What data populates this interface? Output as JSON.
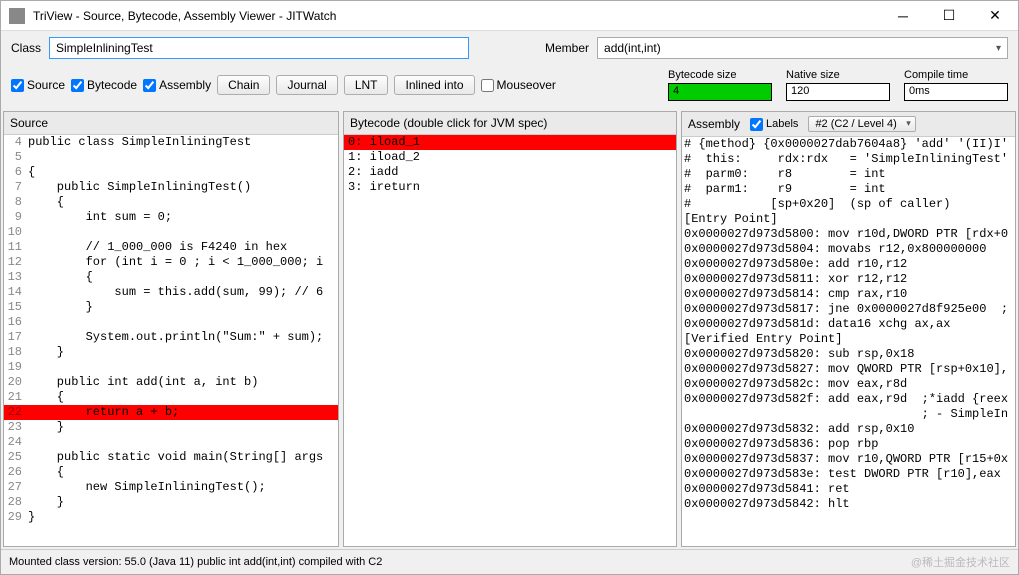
{
  "title": "TriView - Source, Bytecode, Assembly Viewer - JITWatch",
  "toolbar": {
    "class_label": "Class",
    "class_value": "SimpleInliningTest",
    "member_label": "Member",
    "member_value": "add(int,int)",
    "chk_source": "Source",
    "chk_bytecode": "Bytecode",
    "chk_assembly": "Assembly",
    "btn_chain": "Chain",
    "btn_journal": "Journal",
    "btn_lnt": "LNT",
    "btn_inlined": "Inlined into",
    "chk_mouseover": "Mouseover",
    "stats": {
      "bytecode_label": "Bytecode size",
      "bytecode_value": "4",
      "native_label": "Native size",
      "native_value": "120",
      "compile_label": "Compile time",
      "compile_value": "0ms"
    }
  },
  "panels": {
    "source": {
      "header": "Source",
      "lines": [
        {
          "n": 4,
          "t": "public class SimpleInliningTest"
        },
        {
          "n": 5,
          "t": ""
        },
        {
          "n": 6,
          "t": "{"
        },
        {
          "n": 7,
          "t": "    public SimpleInliningTest()"
        },
        {
          "n": 8,
          "t": "    {"
        },
        {
          "n": 9,
          "t": "        int sum = 0;"
        },
        {
          "n": 10,
          "t": ""
        },
        {
          "n": 11,
          "t": "        // 1_000_000 is F4240 in hex"
        },
        {
          "n": 12,
          "t": "        for (int i = 0 ; i < 1_000_000; i"
        },
        {
          "n": 13,
          "t": "        {"
        },
        {
          "n": 14,
          "t": "            sum = this.add(sum, 99); // 6"
        },
        {
          "n": 15,
          "t": "        }"
        },
        {
          "n": 16,
          "t": ""
        },
        {
          "n": 17,
          "t": "        System.out.println(\"Sum:\" + sum);"
        },
        {
          "n": 18,
          "t": "    }"
        },
        {
          "n": 19,
          "t": ""
        },
        {
          "n": 20,
          "t": "    public int add(int a, int b)"
        },
        {
          "n": 21,
          "t": "    {"
        },
        {
          "n": 22,
          "t": "        return a + b;",
          "hl": true
        },
        {
          "n": 23,
          "t": "    }"
        },
        {
          "n": 24,
          "t": ""
        },
        {
          "n": 25,
          "t": "    public static void main(String[] args"
        },
        {
          "n": 26,
          "t": "    {"
        },
        {
          "n": 27,
          "t": "        new SimpleInliningTest();"
        },
        {
          "n": 28,
          "t": "    }"
        },
        {
          "n": 29,
          "t": "}"
        }
      ]
    },
    "bytecode": {
      "header": "Bytecode (double click for JVM spec)",
      "lines": [
        {
          "t": "0: iload_1",
          "hl": true
        },
        {
          "t": "1: iload_2"
        },
        {
          "t": "2: iadd"
        },
        {
          "t": "3: ireturn"
        }
      ]
    },
    "assembly": {
      "header": "Assembly",
      "labels_chk": "Labels",
      "combo": "#2 (C2 / Level 4)",
      "lines": [
        "# {method} {0x0000027dab7604a8} 'add' '(II)I'",
        "#  this:     rdx:rdx   = 'SimpleInliningTest'",
        "#  parm0:    r8        = int",
        "#  parm1:    r9        = int",
        "#           [sp+0x20]  (sp of caller)",
        "[Entry Point]",
        "0x0000027d973d5800: mov r10d,DWORD PTR [rdx+0",
        "0x0000027d973d5804: movabs r12,0x800000000",
        "0x0000027d973d580e: add r10,r12",
        "0x0000027d973d5811: xor r12,r12",
        "0x0000027d973d5814: cmp rax,r10",
        "0x0000027d973d5817: jne 0x0000027d8f925e00  ;",
        "0x0000027d973d581d: data16 xchg ax,ax",
        "[Verified Entry Point]",
        "0x0000027d973d5820: sub rsp,0x18",
        "0x0000027d973d5827: mov QWORD PTR [rsp+0x10],",
        "",
        "0x0000027d973d582c: mov eax,r8d",
        "0x0000027d973d582f: add eax,r9d  ;*iadd {reex",
        "                                 ; - SimpleIn",
        "0x0000027d973d5832: add rsp,0x10",
        "0x0000027d973d5836: pop rbp",
        "0x0000027d973d5837: mov r10,QWORD PTR [r15+0x",
        "0x0000027d973d583e: test DWORD PTR [r10],eax",
        "0x0000027d973d5841: ret",
        "0x0000027d973d5842: hlt"
      ]
    }
  },
  "statusbar": "Mounted class version: 55.0 (Java 11) public int add(int,int) compiled with C2",
  "watermark": "@稀土掘金技术社区"
}
